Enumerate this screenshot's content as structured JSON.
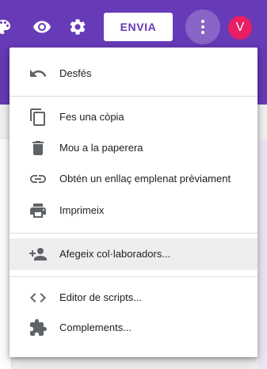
{
  "header": {
    "send_label": "ENVIA",
    "avatar_initial": "V",
    "brand_color": "#673ab7",
    "avatar_color": "#e91e63",
    "icons": [
      "palette-icon",
      "eye-icon",
      "gear-icon",
      "more-vert-icon"
    ]
  },
  "menu": {
    "items": [
      {
        "label": "Desfés",
        "icon": "undo-icon"
      },
      {
        "label": "Fes una còpia",
        "icon": "copy-icon"
      },
      {
        "label": "Mou a la paperera",
        "icon": "trash-icon"
      },
      {
        "label": "Obtén un enllaç emplenat prèviament",
        "icon": "link-icon"
      },
      {
        "label": "Imprimeix",
        "icon": "print-icon"
      },
      {
        "label": "Afegeix col·laboradors...",
        "icon": "add-people-icon",
        "highlighted": true
      },
      {
        "label": "Editor de scripts...",
        "icon": "code-icon"
      },
      {
        "label": "Complements...",
        "icon": "puzzle-icon"
      }
    ]
  }
}
